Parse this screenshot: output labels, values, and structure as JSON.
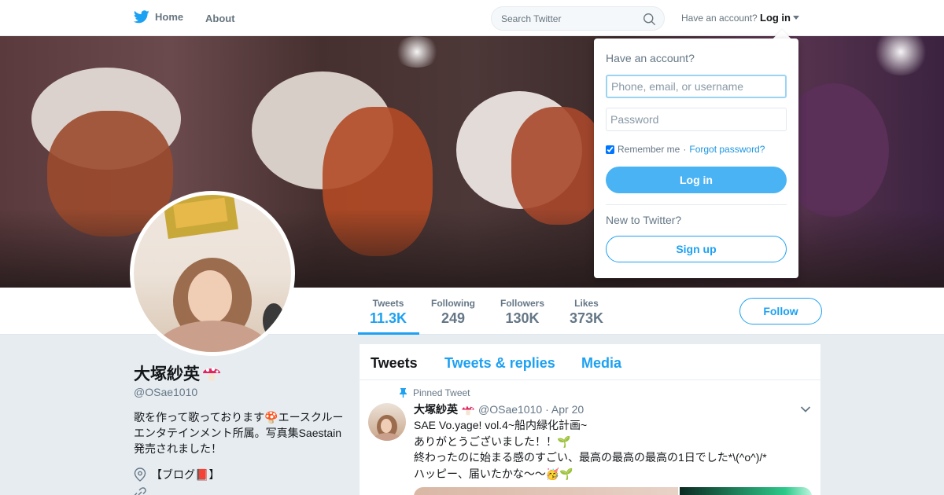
{
  "nav": {
    "home_label": "Home",
    "about_label": "About",
    "search_placeholder": "Search Twitter",
    "have_account": "Have an account?",
    "login_label": "Log in"
  },
  "profile": {
    "name": "大塚紗英",
    "handle": "@OSae1010",
    "bio": "歌を作って歌っております🍄エースクルーエンタテインメント所属。写真集Saestain発売されました！",
    "blog": "【ブログ📕】",
    "follow_label": "Follow"
  },
  "stats": [
    {
      "label": "Tweets",
      "value": "11.3K"
    },
    {
      "label": "Following",
      "value": "249"
    },
    {
      "label": "Followers",
      "value": "130K"
    },
    {
      "label": "Likes",
      "value": "373K"
    }
  ],
  "timeline": {
    "tabs": [
      "Tweets",
      "Tweets & replies",
      "Media"
    ],
    "pinned_label": "Pinned Tweet",
    "tweet": {
      "name": "大塚紗英",
      "handle": "@OSae1010",
      "date": "· Apr 20",
      "lines": [
        "SAE Vo.yage! vol.4~船内緑化計画~",
        "ありがとうございました！！🌱",
        "終わったのに始まる感のすごい、最高の最高の最高の1日でした*\\(^o^)/*",
        "ハッピー、届いたかな～～🥳🌱"
      ]
    }
  },
  "login_dropdown": {
    "title": "Have an account?",
    "username_placeholder": "Phone, email, or username",
    "password_placeholder": "Password",
    "remember_label": "Remember me",
    "separator": "·",
    "forgot_label": "Forgot password?",
    "login_button": "Log in",
    "new_label": "New to Twitter?",
    "signup_button": "Sign up"
  },
  "colors": {
    "accent": "#1da1f2",
    "background": "#e6ecf0"
  }
}
